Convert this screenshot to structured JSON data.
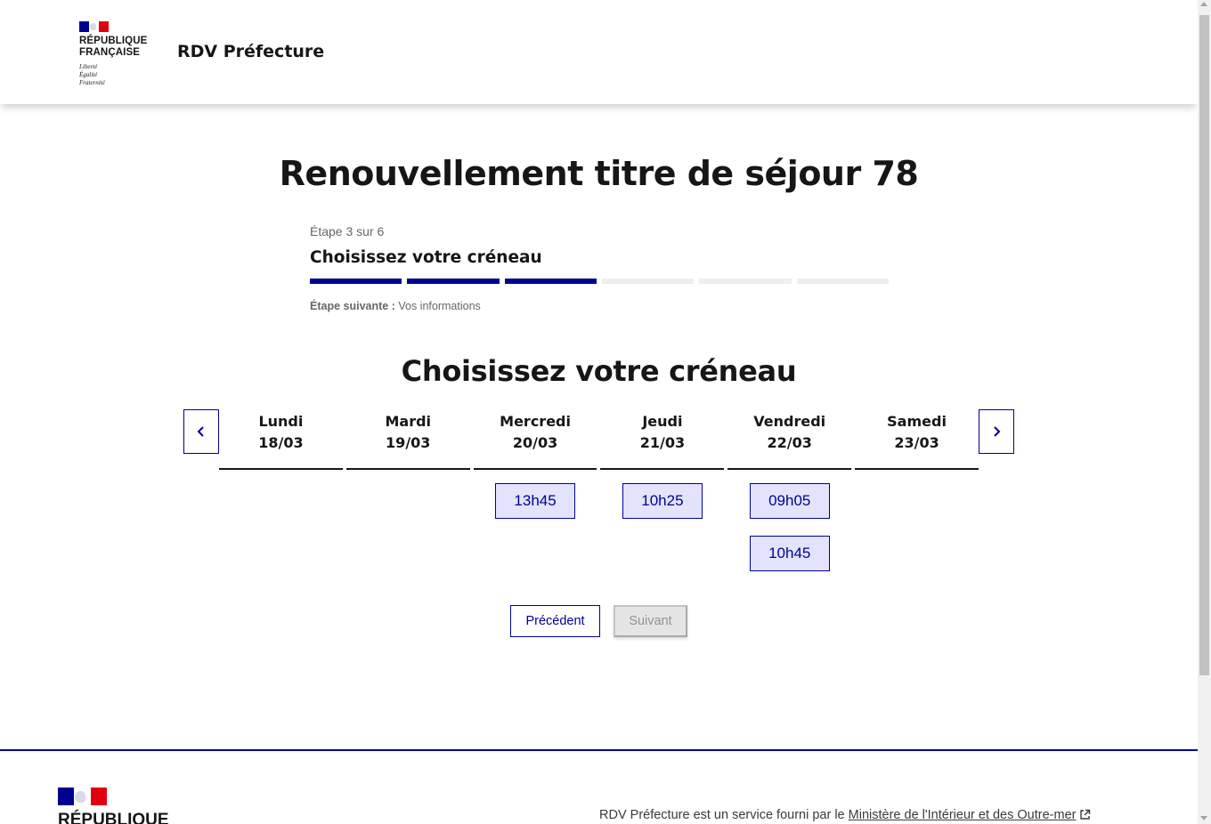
{
  "header": {
    "logo_text": "RÉPUBLIQUE FRANÇAISE",
    "logo_line1": "RÉPUBLIQUE",
    "logo_line2": "FRANÇAISE",
    "motto": [
      "Liberté",
      "Égalité",
      "Fraternité"
    ],
    "service_title": "RDV Préfecture"
  },
  "main": {
    "title": "Renouvellement titre de séjour 78",
    "stepper": {
      "state": "Étape 3 sur 6",
      "current_title": "Choisissez votre créneau",
      "current_step": 3,
      "total_steps": 6,
      "next_label": "Étape suivante :",
      "next_title": "Vos informations"
    },
    "section_title": "Choisissez votre créneau",
    "calendar": {
      "prev_icon": "chevron-left-icon",
      "next_icon": "chevron-right-icon",
      "days": [
        {
          "name": "Lundi",
          "date": "18/03",
          "slots": []
        },
        {
          "name": "Mardi",
          "date": "19/03",
          "slots": []
        },
        {
          "name": "Mercredi",
          "date": "20/03",
          "slots": [
            "13h45"
          ]
        },
        {
          "name": "Jeudi",
          "date": "21/03",
          "slots": [
            "10h25"
          ]
        },
        {
          "name": "Vendredi",
          "date": "22/03",
          "slots": [
            "09h05",
            "10h45"
          ]
        },
        {
          "name": "Samedi",
          "date": "23/03",
          "slots": []
        }
      ]
    },
    "actions": {
      "previous_label": "Précédent",
      "next_label": "Suivant"
    }
  },
  "footer": {
    "logo_line1": "RÉPUBLIQUE",
    "description_prefix": "RDV Préfecture est un service fourni par le",
    "link_label": "Ministère de l'Intérieur et des Outre-mer",
    "link_icon": "external-link-icon"
  },
  "colors": {
    "primary": "#000091",
    "slot_background": "#e3e3fd",
    "step_inactive": "#eeeeee",
    "flag_red": "#e1000f"
  }
}
